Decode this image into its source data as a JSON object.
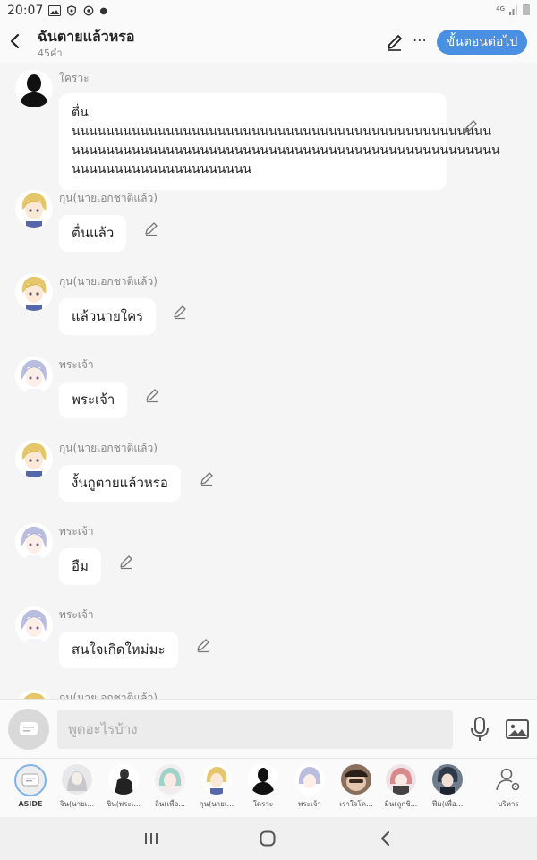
{
  "status_bar": {
    "time": "20:07",
    "network": "4G"
  },
  "header": {
    "title": "ฉันตายแล้วหรอ",
    "subtitle": "45คำ",
    "next_button": "ขั้นตอนต่อไป",
    "accent_color": "#4a90e2"
  },
  "messages": [
    {
      "sender": "ใครวะ",
      "text": "ตื่นนนนนนนนนนนนนนนนนนนนนนนนนนนนนนนนนนนนนนนนนนนนนนนนนนนนนนนนนนนนนนนนนนนนนนนนนนนนนนนนนนนนนนนนนนนนนนนนนนนนนนนนนนนนนนนนนนนนนนนนนนนนนนน",
      "lines": [
        "ตื่นนนนนนนนนนนนนนนนนนนนนนนนนนนนนนนนนนนนนนนนนนนนนนนนนน",
        "นนนนนนนนนนนนนนนนนนนนนนนนนนนนนนนนนนนนนนนนนนนนนนนนนน",
        "นนนนนนนนนนนนนนนนนนนนน"
      ],
      "avatar": "silhouette-avatar"
    },
    {
      "sender": "กุน(นายเอกชาติแล้ว)",
      "text": "ตื่นแล้ว",
      "avatar": "blonde-avatar"
    },
    {
      "sender": "กุน(นายเอกชาติแล้ว)",
      "text": "แล้วนายใคร",
      "avatar": "blonde-avatar"
    },
    {
      "sender": "พระเจ้า",
      "text": "พระเจ้า",
      "avatar": "silver-hair-avatar"
    },
    {
      "sender": "กุน(นายเอกชาติแล้ว)",
      "text": "งั้นกูตายแล้วหรอ",
      "avatar": "blonde-avatar"
    },
    {
      "sender": "พระเจ้า",
      "text": "อืม",
      "avatar": "silver-hair-avatar"
    },
    {
      "sender": "พระเจ้า",
      "text": "สนใจเกิดใหม่มะ",
      "avatar": "silver-hair-avatar"
    },
    {
      "sender": "กุน(นายเอกชาติแล้ว)",
      "text": "",
      "avatar": "blonde-avatar"
    }
  ],
  "input": {
    "placeholder": "พูดอะไรบ้าง"
  },
  "characters": [
    {
      "label": "ASIDE"
    },
    {
      "label": "จิน(นายเ..."
    },
    {
      "label": "ชิน(พระเ..."
    },
    {
      "label": "ลีน(เพื่อ..."
    },
    {
      "label": "กุน(นายเ..."
    },
    {
      "label": "ใครวะ"
    },
    {
      "label": "พระเจ้า"
    },
    {
      "label": "เราใจโค..."
    },
    {
      "label": "มิน(ลูกชิ..."
    },
    {
      "label": "ฟีม(เพื่อ..."
    },
    {
      "label": "บริหาร"
    }
  ]
}
